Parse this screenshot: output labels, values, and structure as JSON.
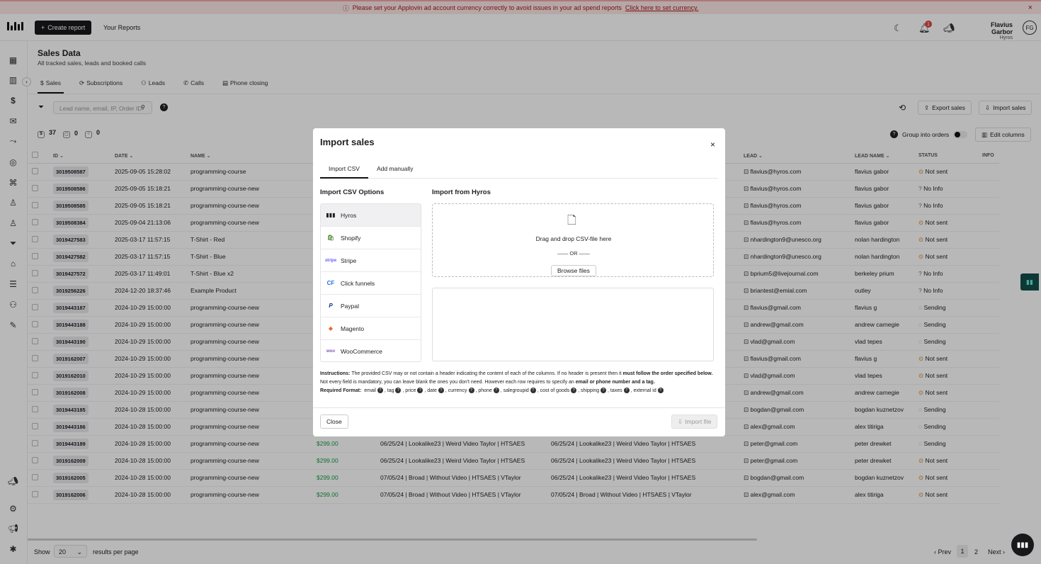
{
  "banner": {
    "text": "Please set your Applovin ad account currency correctly to avoid issues in your ad spend reports",
    "link": "Click here to set currency."
  },
  "topbar": {
    "create_report": "Create report",
    "your_reports": "Your Reports",
    "notif_count": "1",
    "user_name": "Flavius Garbor",
    "user_company": "Hyros",
    "avatar": "FG"
  },
  "page": {
    "title": "Sales Data",
    "subtitle": "All tracked sales, leads and booked calls"
  },
  "tabs": [
    {
      "label": "Sales",
      "icon": "dollar-icon"
    },
    {
      "label": "Subscriptions",
      "icon": "repeat-icon"
    },
    {
      "label": "Leads",
      "icon": "users-icon"
    },
    {
      "label": "Calls",
      "icon": "phone-icon"
    },
    {
      "label": "Phone closing",
      "icon": "clipboard-icon"
    }
  ],
  "search": {
    "placeholder": "Lead name, email, IP, Order ID"
  },
  "actions": {
    "export": "Export sales",
    "import": "Import sales",
    "group_into_orders": "Group into orders",
    "edit_columns": "Edit columns"
  },
  "stats": [
    {
      "value": "37"
    },
    {
      "value": "0"
    },
    {
      "value": "0"
    }
  ],
  "table": {
    "columns": {
      "id": "ID",
      "date": "DATE",
      "name": "NAME",
      "lead": "LEAD",
      "lead_name": "LEAD NAME",
      "status": "STATUS",
      "info": "INFO"
    },
    "rows": [
      {
        "id": "3019508587",
        "date": "2025-09-05 15:28:02",
        "name": "programming-course",
        "price": "",
        "c1": "",
        "c2": "",
        "lead": "flavius@hyros.com",
        "lead_name": "flavius gabor",
        "status": "Not sent"
      },
      {
        "id": "3019508586",
        "date": "2025-09-05 15:18:21",
        "name": "programming-course-new",
        "price": "",
        "c1": "",
        "c2": "",
        "lead": "flavius@hyros.com",
        "lead_name": "flavius gabor",
        "status": "No Info"
      },
      {
        "id": "3019508585",
        "date": "2025-09-05 15:18:21",
        "name": "programming-course-new",
        "price": "",
        "c1": "",
        "c2": "",
        "lead": "flavius@hyros.com",
        "lead_name": "flavius gabor",
        "status": "No Info"
      },
      {
        "id": "3019508384",
        "date": "2025-09-04 21:13:06",
        "name": "programming-course-new",
        "price": "",
        "c1": "",
        "c2": "",
        "lead": "flavius@hyros.com",
        "lead_name": "flavius gabor",
        "status": "Not sent"
      },
      {
        "id": "3019427583",
        "date": "2025-03-17 11:57:15",
        "name": "T-Shirt - Red",
        "price": "",
        "c1": "",
        "c2": "",
        "lead": "nhardington9@unesco.org",
        "lead_name": "nolan hardington",
        "status": "Not sent"
      },
      {
        "id": "3019427582",
        "date": "2025-03-17 11:57:15",
        "name": "T-Shirt - Blue",
        "price": "",
        "c1": "",
        "c2": "",
        "lead": "nhardington9@unesco.org",
        "lead_name": "nolan hardington",
        "status": "Not sent"
      },
      {
        "id": "3019427572",
        "date": "2025-03-17 11:49:01",
        "name": "T-Shirt - Blue x2",
        "price": "",
        "c1": "",
        "c2": "",
        "lead": "bprium5@livejournal.com",
        "lead_name": "berkeley prium",
        "status": "No Info"
      },
      {
        "id": "3019256226",
        "date": "2024-12-20 18:37:46",
        "name": "Example Product",
        "price": "",
        "c1": "",
        "c2": "",
        "lead": "briantest@emial.com",
        "lead_name": "outley",
        "status": "No Info"
      },
      {
        "id": "3019443187",
        "date": "2024-10-29 15:00:00",
        "name": "programming-course-new",
        "price": "",
        "c1": "",
        "c2": "",
        "lead": "flavius@gmail.com",
        "lead_name": "flavius g",
        "status": "Sending"
      },
      {
        "id": "3019443188",
        "date": "2024-10-29 15:00:00",
        "name": "programming-course-new",
        "price": "",
        "c1": "",
        "c2": "",
        "lead": "andrew@gmail.com",
        "lead_name": "andrew carnegie",
        "status": "Sending"
      },
      {
        "id": "3019443190",
        "date": "2024-10-29 15:00:00",
        "name": "programming-course-new",
        "price": "",
        "c1": "",
        "c2": "",
        "lead": "vlad@gmail.com",
        "lead_name": "vlad tepes",
        "status": "Sending"
      },
      {
        "id": "3019162007",
        "date": "2024-10-29 15:00:00",
        "name": "programming-course-new",
        "price": "",
        "c1": "",
        "c2": "",
        "lead": "flavius@gmail.com",
        "lead_name": "flavius g",
        "status": "Not sent"
      },
      {
        "id": "3019162010",
        "date": "2024-10-29 15:00:00",
        "name": "programming-course-new",
        "price": "",
        "c1": "",
        "c2": "",
        "lead": "vlad@gmail.com",
        "lead_name": "vlad tepes",
        "status": "Not sent"
      },
      {
        "id": "3019162008",
        "date": "2024-10-29 15:00:00",
        "name": "programming-course-new",
        "price": "",
        "c1": "",
        "c2": "",
        "lead": "andrew@gmail.com",
        "lead_name": "andrew carnegie",
        "status": "Not sent"
      },
      {
        "id": "3019443185",
        "date": "2024-10-28 15:00:00",
        "name": "programming-course-new",
        "price": "",
        "c1": "",
        "c2": "",
        "lead": "bogdan@gmail.com",
        "lead_name": "bogdan kuznetzov",
        "status": "Sending"
      },
      {
        "id": "3019443186",
        "date": "2024-10-28 15:00:00",
        "name": "programming-course-new",
        "price": "",
        "c1": "",
        "c2": "",
        "lead": "alex@gmail.com",
        "lead_name": "alex titiriga",
        "status": "Sending"
      },
      {
        "id": "3019443189",
        "date": "2024-10-28 15:00:00",
        "name": "programming-course-new",
        "price": "$299.00",
        "c1": "06/25/24 | Lookalike23 | Weird Video Taylor | HTSAES",
        "c2": "06/25/24 | Lookalike23 | Weird Video Taylor | HTSAES",
        "lead": "peter@gmail.com",
        "lead_name": "peter drewket",
        "status": "Sending"
      },
      {
        "id": "3019162009",
        "date": "2024-10-28 15:00:00",
        "name": "programming-course-new",
        "price": "$299.00",
        "c1": "06/25/24 | Lookalike23 | Weird Video Taylor | HTSAES",
        "c2": "06/25/24 | Lookalike23 | Weird Video Taylor | HTSAES",
        "lead": "peter@gmail.com",
        "lead_name": "peter drewket",
        "status": "Not sent"
      },
      {
        "id": "3019162005",
        "date": "2024-10-28 15:00:00",
        "name": "programming-course-new",
        "price": "$299.00",
        "c1": "07/05/24 | Broad | Without Video | HTSAES | VTaylor",
        "c2": "06/25/24 | Lookalike23 | Weird Video Taylor | HTSAES",
        "lead": "bogdan@gmail.com",
        "lead_name": "bogdan kuznetzov",
        "status": "Not sent"
      },
      {
        "id": "3019162006",
        "date": "2024-10-28 15:00:00",
        "name": "programming-course-new",
        "price": "$299.00",
        "c1": "07/05/24 | Broad | Without Video | HTSAES | VTaylor",
        "c2": "07/05/24 | Broad | Without Video | HTSAES | VTaylor",
        "lead": "alex@gmail.com",
        "lead_name": "alex titiriga",
        "status": "Not sent"
      }
    ]
  },
  "footer": {
    "show": "Show",
    "per_page": "20",
    "results_per_page": "results per page",
    "prev": "Prev",
    "page1": "1",
    "page2": "2",
    "next": "Next"
  },
  "modal": {
    "title": "Import sales",
    "tabs": [
      "Import CSV",
      "Add manually"
    ],
    "left_heading": "Import CSV Options",
    "right_heading": "Import from Hyros",
    "options": [
      {
        "label": "Hyros",
        "icon": "hyros-logo-icon"
      },
      {
        "label": "Shopify",
        "icon": "shopify-logo-icon"
      },
      {
        "label": "Stripe",
        "icon": "stripe-logo-icon"
      },
      {
        "label": "Click funnels",
        "icon": "clickfunnels-logo-icon"
      },
      {
        "label": "Paypal",
        "icon": "paypal-logo-icon"
      },
      {
        "label": "Magento",
        "icon": "magento-logo-icon"
      },
      {
        "label": "WooCommerce",
        "icon": "woocommerce-logo-icon"
      }
    ],
    "drop_text": "Drag and drop CSV-file here",
    "or": "OR",
    "browse": "Browse files",
    "instr_label": "Instructions:",
    "instr_text": "The provided CSV may or not contain a header indicating the content of each of the columns. If no header is present then it",
    "instr_bold": "must follow the order specified below.",
    "instr_text2": "Not every field is mandatory, you can leave blank the ones you don't need. However each row requires to specify an",
    "instr_bold2": "email or phone number and a tag.",
    "req_label": "Required Format:",
    "fields": [
      "email",
      "tag",
      "price",
      "date",
      "currency",
      "phone",
      "salegroupid",
      "cost of goods",
      "shipping",
      "taxes",
      "external id"
    ],
    "close": "Close",
    "import_file": "Import file"
  },
  "colors": {
    "accent": "#18181b",
    "price": "#1c9c4a",
    "banner_bg": "#fde8e8",
    "banner_text": "#a61b1b"
  }
}
